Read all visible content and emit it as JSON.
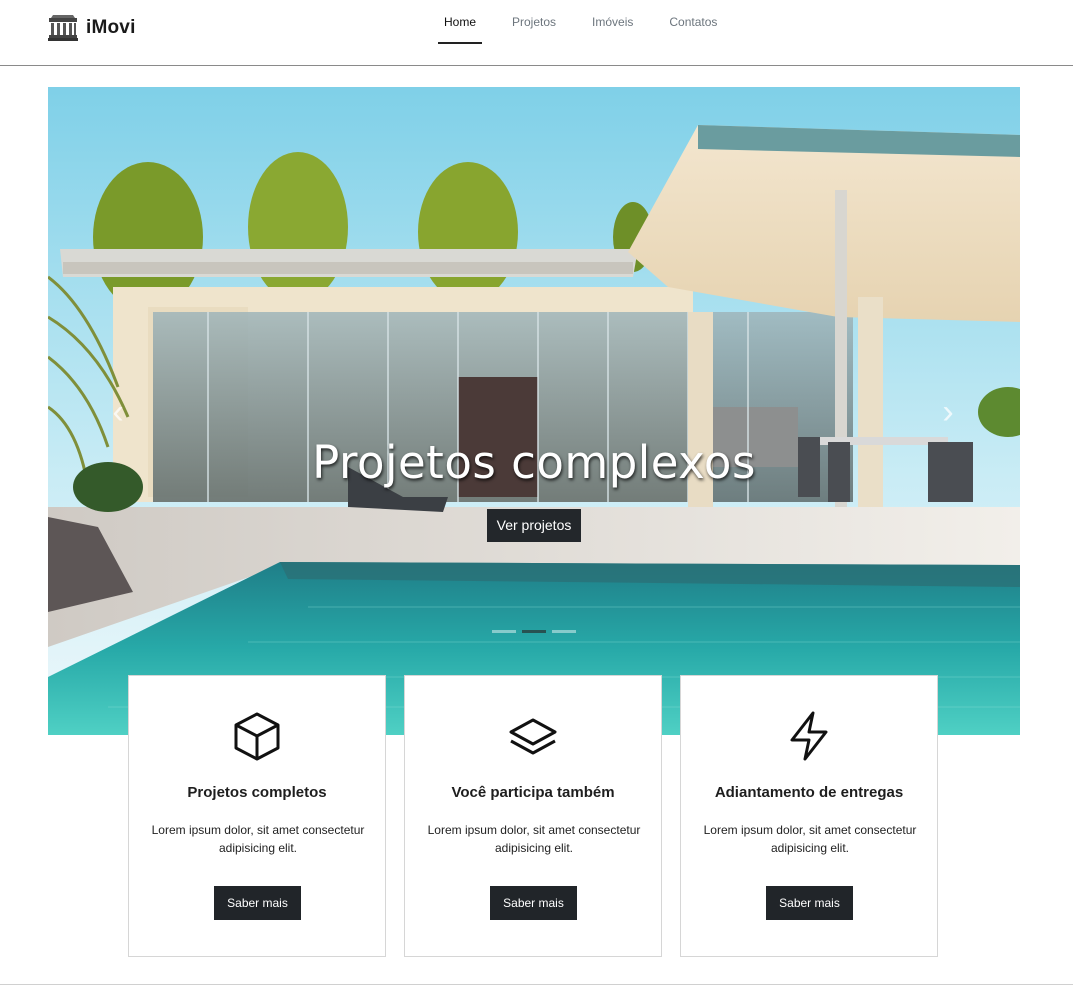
{
  "brand": {
    "name": "iMovi",
    "icon": "building-columns-icon"
  },
  "nav": {
    "items": [
      {
        "label": "Home",
        "active": true
      },
      {
        "label": "Projetos",
        "active": false
      },
      {
        "label": "Imóveis",
        "active": false
      },
      {
        "label": "Contatos",
        "active": false
      }
    ]
  },
  "carousel": {
    "slide_count": 3,
    "active_slide": 2,
    "caption_title": "Projetos complexos",
    "caption_button": "Ver projetos",
    "prev_icon": "chevron-left-icon",
    "next_icon": "chevron-right-icon"
  },
  "cards": [
    {
      "icon": "box-icon",
      "title": "Projetos completos",
      "text": "Lorem ipsum dolor, sit amet consectetur adipisicing elit.",
      "button": "Saber mais"
    },
    {
      "icon": "layers-icon",
      "title": "Você participa também",
      "text": "Lorem ipsum dolor, sit amet consectetur adipisicing elit.",
      "button": "Saber mais"
    },
    {
      "icon": "zap-icon",
      "title": "Adiantamento de entregas",
      "text": "Lorem ipsum dolor, sit amet consectetur adipisicing elit.",
      "button": "Saber mais"
    }
  ],
  "colors": {
    "dark_button": "#212529",
    "divider": "#8a8a8a"
  }
}
